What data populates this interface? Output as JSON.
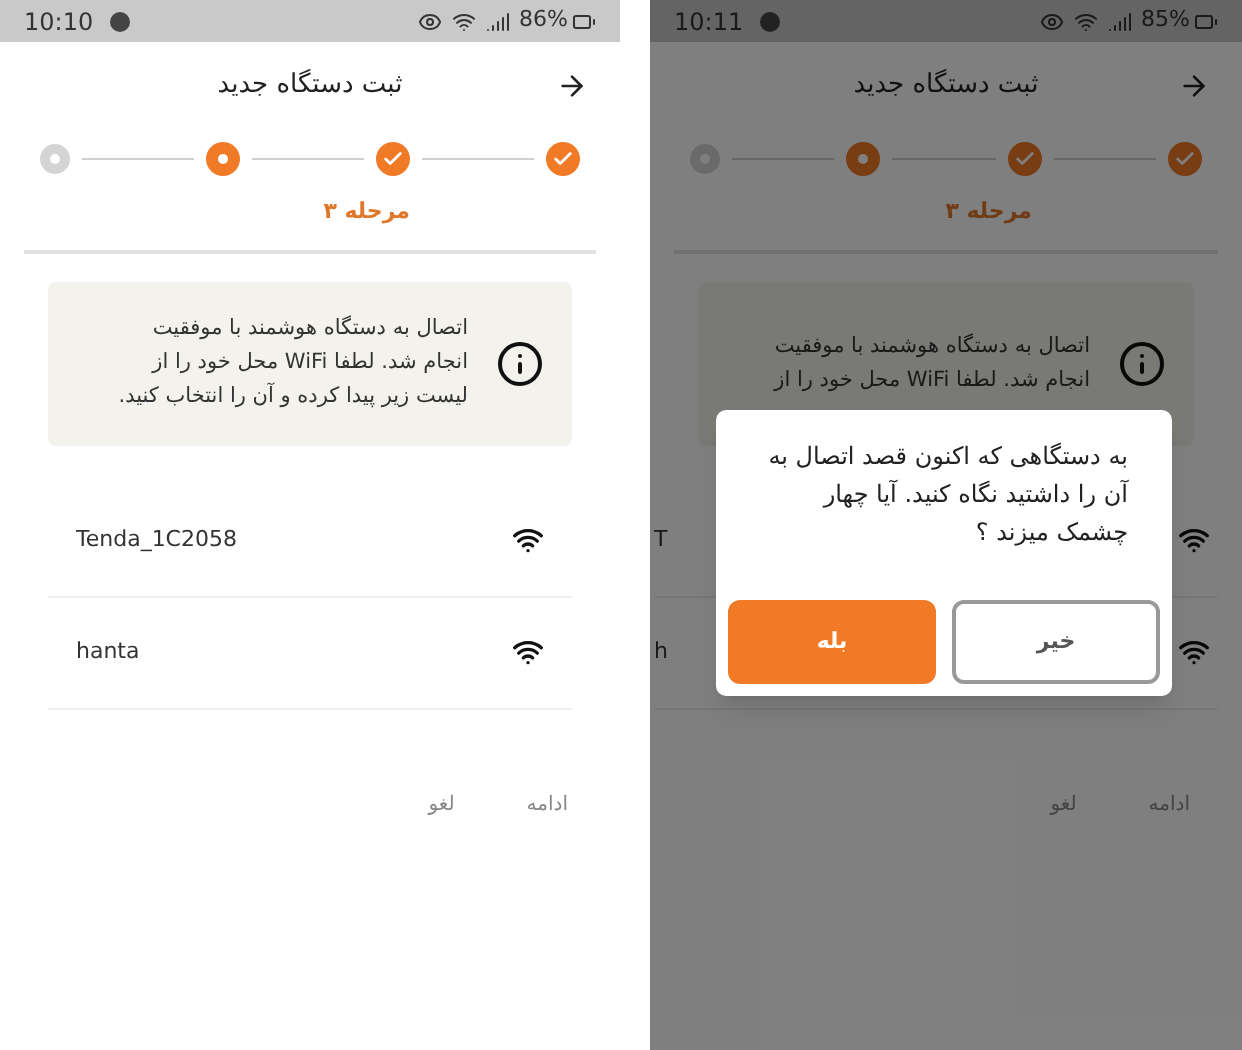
{
  "screens": [
    {
      "status_bar": {
        "time": "10:11",
        "battery": "85%"
      },
      "header": {
        "title": "ثبت دستگاه جدید"
      },
      "stepper": {
        "steps": [
          {
            "kind": "done"
          },
          {
            "kind": "done"
          },
          {
            "kind": "current"
          },
          {
            "kind": "pending"
          }
        ],
        "label": "مرحله ۳"
      },
      "info": {
        "lines": [
          "اتصال به دستگاه هوشمند با موفقیت",
          "انجام شد. لطفا WiFi محل خود را از"
        ]
      },
      "networks": [
        {
          "name": "T"
        },
        {
          "name": "h"
        }
      ],
      "actions": [
        "ادامه",
        "لغو"
      ],
      "dialog": {
        "message": "به دستگاهی که اکنون قصد اتصال به آن را داشتید نگاه کنید. آیا چهار چشمک میزند ؟",
        "buttons": [
          {
            "label": "خیر",
            "kind": "secondary"
          },
          {
            "label": "بله",
            "kind": "primary"
          }
        ]
      }
    },
    {
      "status_bar": {
        "time": "10:10",
        "battery": "86%"
      },
      "header": {
        "title": "ثبت دستگاه جدید"
      },
      "stepper": {
        "steps": [
          {
            "kind": "done"
          },
          {
            "kind": "done"
          },
          {
            "kind": "current"
          },
          {
            "kind": "pending"
          }
        ],
        "label": "مرحله ۳"
      },
      "info": {
        "lines": [
          "اتصال به دستگاه هوشمند با موفقیت",
          "انجام شد. لطفا WiFi محل خود را از",
          "لیست زیر پیدا کرده و آن را انتخاب کنید."
        ]
      },
      "networks": [
        {
          "name": "Tenda_1C2058"
        },
        {
          "name": "hanta"
        }
      ],
      "actions": [
        "ادامه",
        "لغو"
      ]
    }
  ]
}
